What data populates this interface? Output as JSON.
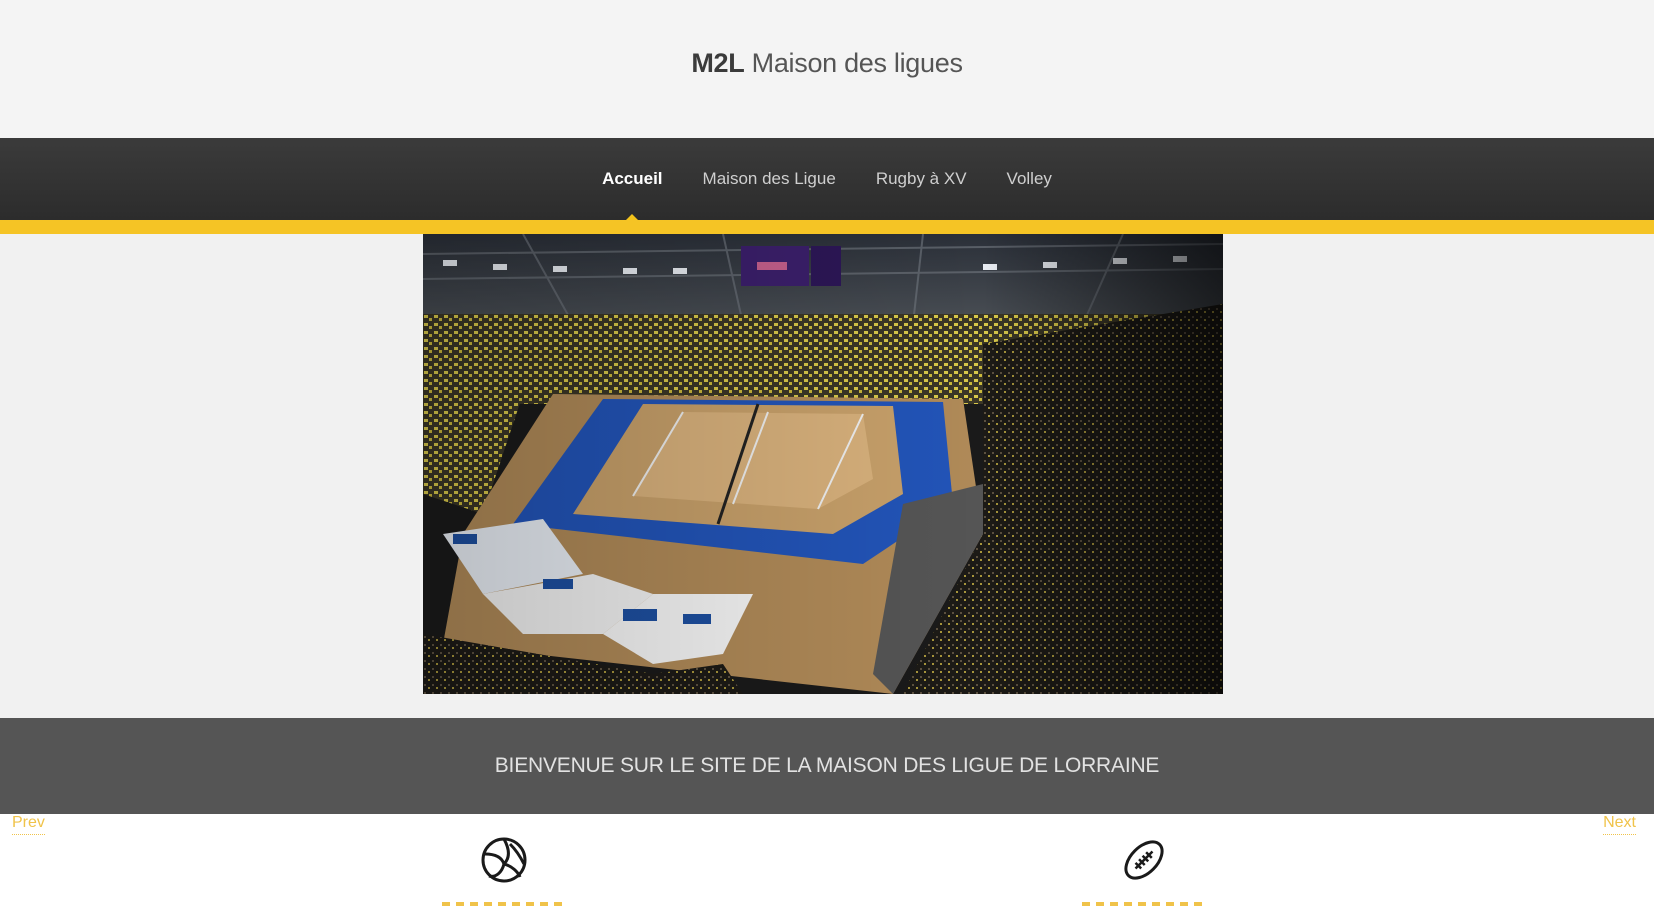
{
  "header": {
    "brand_strong": "M2L",
    "brand_light": "Maison des ligues"
  },
  "nav": {
    "items": [
      {
        "label": "Accueil",
        "active": true
      },
      {
        "label": "Maison des Ligue",
        "active": false
      },
      {
        "label": "Rugby à XV",
        "active": false
      },
      {
        "label": "Volley",
        "active": false
      }
    ]
  },
  "hero": {
    "image_semantic": "volleyball-arena-photo"
  },
  "banner": {
    "text": "BIENVENUE SUR LE SITE DE LA MAISON DES LIGUE DE LORRAINE"
  },
  "carousel": {
    "prev_label": "Prev",
    "next_label": "Next"
  },
  "features": [
    {
      "icon": "volleyball-icon"
    },
    {
      "icon": "rugby-ball-icon"
    }
  ],
  "colors": {
    "accent": "#f5c425",
    "nav_bg": "#333333",
    "banner_bg": "#555555"
  }
}
